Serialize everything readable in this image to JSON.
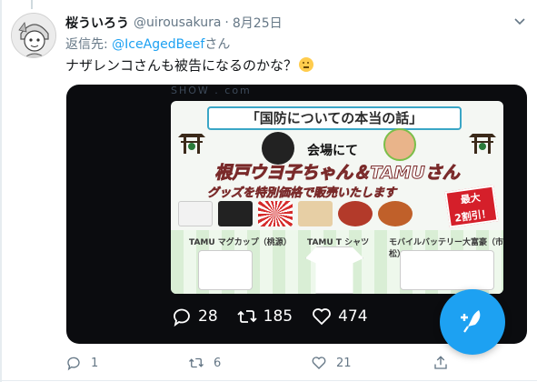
{
  "tweet": {
    "display_name": "桜ういろう",
    "handle": "@uirousakura",
    "separator": "·",
    "date": "8月25日",
    "replying_prefix": "返信先:",
    "replying_mention": "@IceAgedBeef",
    "replying_suffix": "さん",
    "text": "ナザレンコさんも被告になるのかな？",
    "emoji": "thinking-face"
  },
  "media": {
    "topbar_text": "SHOW . com",
    "flyer": {
      "title": "「国防についての本当の話」",
      "venue": "会場にて",
      "headline": "根戸ウヨ子ちゃん＆TAMUさん",
      "subline": "グッズを特別価格で販売いたします",
      "sale_line1": "最大",
      "sale_line2": "2割引！",
      "panel_label_1": "TAMU マグカップ（桃源）",
      "panel_label_2": "TAMU T シャツ",
      "panel_label_3": "モバイルバッテリー大富豪（市松）"
    },
    "stats": {
      "replies": "28",
      "retweets": "185",
      "likes": "474"
    }
  },
  "actions": {
    "reply_count": "1",
    "retweet_count": "6",
    "like_count": "21"
  },
  "colors": {
    "accent": "#1da1f2",
    "text_primary": "#14171a",
    "text_secondary": "#657786",
    "media_bg": "#0b0c0f"
  }
}
